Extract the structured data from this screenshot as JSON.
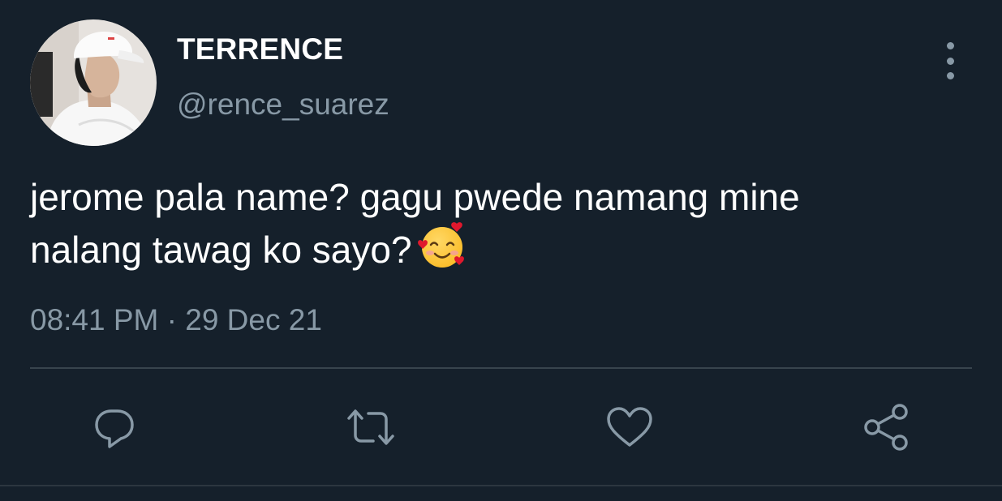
{
  "user": {
    "display_name": "TERRENCE",
    "handle": "@rence_suarez",
    "avatar": "profile-photo"
  },
  "tweet": {
    "text_line1": "jerome pala name? gagu pwede namang mine",
    "text_line2": "nalang tawag ko sayo?",
    "emoji": "smiling-face-with-hearts",
    "timestamp": "08:41 PM · 29 Dec 21"
  },
  "actions": {
    "reply": "reply-icon",
    "retweet": "retweet-icon",
    "like": "heart-icon",
    "share": "share-icon",
    "more": "more-vertical-icon"
  },
  "colors": {
    "background": "#15202b",
    "primary_text": "#ffffff",
    "secondary_text": "#8899a6",
    "divider": "#38444d"
  }
}
